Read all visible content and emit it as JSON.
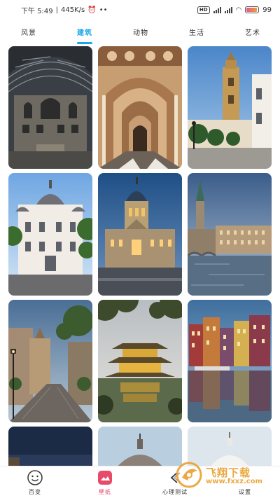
{
  "status_bar": {
    "time": "下午 5:49",
    "speed": "445K/s",
    "dots": "••",
    "hd": "HD",
    "battery_percent": "99"
  },
  "tabs": [
    {
      "label": "风景",
      "active": false
    },
    {
      "label": "建筑",
      "active": true
    },
    {
      "label": "动物",
      "active": false
    },
    {
      "label": "生活",
      "active": false
    },
    {
      "label": "艺术",
      "active": false
    }
  ],
  "gallery": {
    "images": [
      "museum-hall-arches-interior",
      "ornate-arcade-corridor",
      "church-bell-tower-blue-sky",
      "white-baroque-palace-dome",
      "domed-cathedral-at-dusk",
      "river-city-church-spire",
      "narrow-cobblestone-street",
      "golden-pagoda-reflection-lake",
      "colorful-canal-houses-reflection",
      "night-sky-partial",
      "dome-roof-partial",
      "white-dome-partial"
    ]
  },
  "bottom_nav": [
    {
      "label": "百变",
      "icon": "smiley-face-icon",
      "active": false
    },
    {
      "label": "壁纸",
      "icon": "wallpaper-icon",
      "active": true
    },
    {
      "label": "心理测试",
      "icon": "chevron-left-icon",
      "active": false
    },
    {
      "label": "设置",
      "icon": "settings-icon",
      "active": false
    }
  ],
  "watermark": {
    "name": "飞翔下载",
    "url": "www.fxxz.com"
  },
  "colors": {
    "accent": "#1da7e8",
    "nav_active": "#e84a6a",
    "watermark": "#e9a235"
  }
}
